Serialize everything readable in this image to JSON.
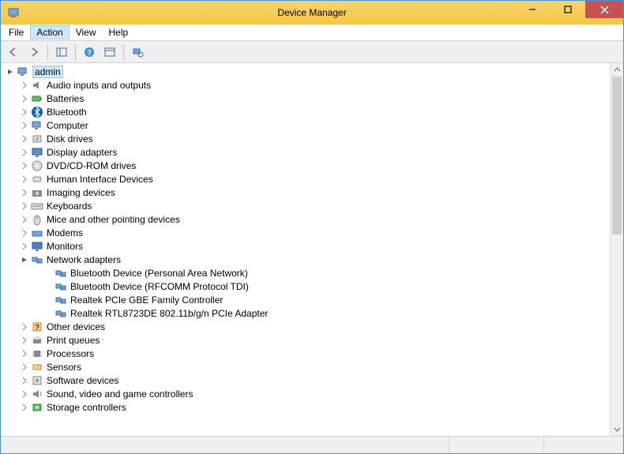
{
  "window": {
    "title": "Device Manager"
  },
  "menu": {
    "file": "File",
    "action": "Action",
    "view": "View",
    "help": "Help"
  },
  "tree": {
    "root": "admin",
    "nodes": [
      {
        "label": "Audio inputs and outputs",
        "icon": "audio",
        "expanded": false,
        "depth": 1
      },
      {
        "label": "Batteries",
        "icon": "battery",
        "expanded": false,
        "depth": 1
      },
      {
        "label": "Bluetooth",
        "icon": "bluetooth",
        "expanded": false,
        "depth": 1
      },
      {
        "label": "Computer",
        "icon": "computer",
        "expanded": false,
        "depth": 1
      },
      {
        "label": "Disk drives",
        "icon": "disk",
        "expanded": false,
        "depth": 1
      },
      {
        "label": "Display adapters",
        "icon": "display",
        "expanded": false,
        "depth": 1
      },
      {
        "label": "DVD/CD-ROM drives",
        "icon": "dvd",
        "expanded": false,
        "depth": 1
      },
      {
        "label": "Human Interface Devices",
        "icon": "hid",
        "expanded": false,
        "depth": 1
      },
      {
        "label": "Imaging devices",
        "icon": "imaging",
        "expanded": false,
        "depth": 1
      },
      {
        "label": "Keyboards",
        "icon": "keyboard",
        "expanded": false,
        "depth": 1
      },
      {
        "label": "Mice and other pointing devices",
        "icon": "mouse",
        "expanded": false,
        "depth": 1
      },
      {
        "label": "Modems",
        "icon": "modem",
        "expanded": false,
        "depth": 1
      },
      {
        "label": "Monitors",
        "icon": "monitor",
        "expanded": false,
        "depth": 1
      },
      {
        "label": "Network adapters",
        "icon": "network",
        "expanded": true,
        "depth": 1
      },
      {
        "label": "Bluetooth Device (Personal Area Network)",
        "icon": "network",
        "depth": 2
      },
      {
        "label": "Bluetooth Device (RFCOMM Protocol TDI)",
        "icon": "network",
        "depth": 2
      },
      {
        "label": "Realtek PCIe GBE Family Controller",
        "icon": "network",
        "depth": 2
      },
      {
        "label": "Realtek RTL8723DE 802.11b/g/n PCIe Adapter",
        "icon": "network",
        "depth": 2
      },
      {
        "label": "Other devices",
        "icon": "other",
        "expanded": false,
        "depth": 1
      },
      {
        "label": "Print queues",
        "icon": "printer",
        "expanded": false,
        "depth": 1
      },
      {
        "label": "Processors",
        "icon": "cpu",
        "expanded": false,
        "depth": 1
      },
      {
        "label": "Sensors",
        "icon": "sensor",
        "expanded": false,
        "depth": 1
      },
      {
        "label": "Software devices",
        "icon": "software",
        "expanded": false,
        "depth": 1
      },
      {
        "label": "Sound, video and game controllers",
        "icon": "sound",
        "expanded": false,
        "depth": 1
      },
      {
        "label": "Storage controllers",
        "icon": "storage",
        "expanded": false,
        "depth": 1
      }
    ]
  }
}
